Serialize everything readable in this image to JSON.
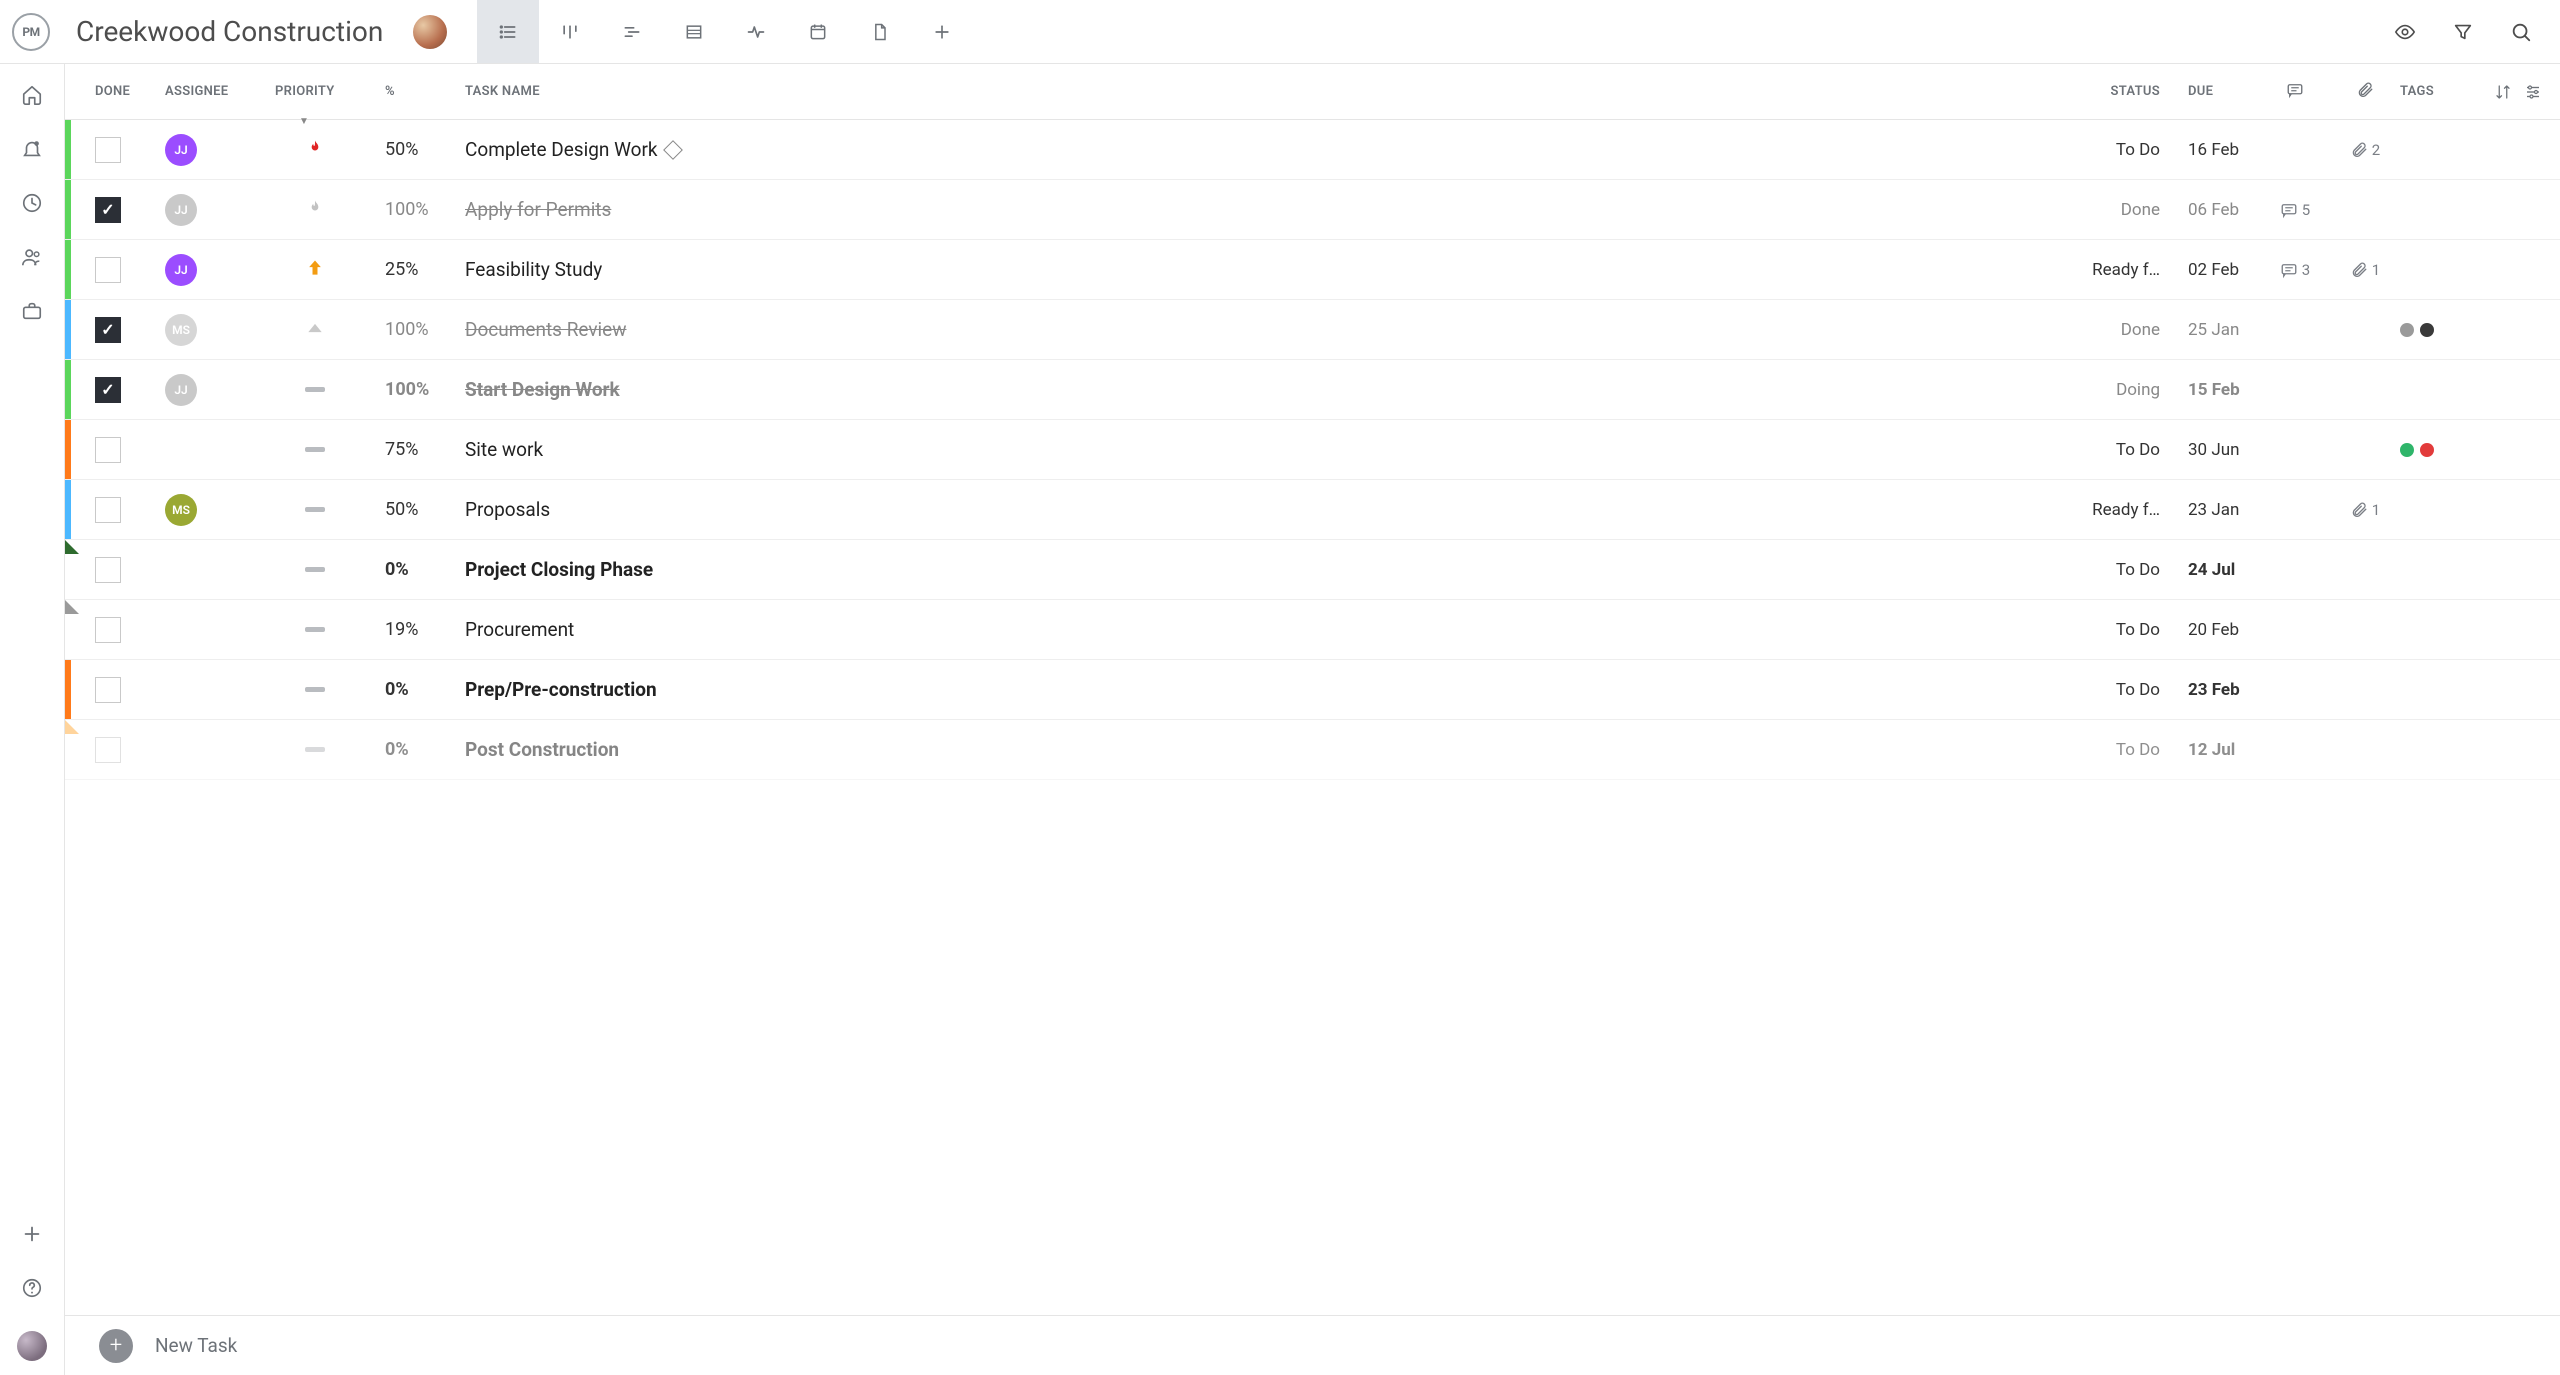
{
  "header": {
    "logo_text": "PM",
    "project_title": "Creekwood Construction"
  },
  "columns": {
    "done": "DONE",
    "assignee": "ASSIGNEE",
    "priority": "PRIORITY",
    "pct": "%",
    "name": "TASK NAME",
    "status": "STATUS",
    "due": "DUE",
    "tags": "TAGS"
  },
  "footer": {
    "new_task": "New Task"
  },
  "tasks": [
    {
      "done": false,
      "assignee": {
        "initials": "JJ",
        "color": "#9b4dff"
      },
      "priority": "flame-red",
      "pct": "50%",
      "name": "Complete Design Work",
      "milestone": true,
      "status": "To Do",
      "due": "16 Feb",
      "comments": null,
      "attachments": "2",
      "tags": [],
      "stripe": "#5bd65b",
      "bold": false
    },
    {
      "done": true,
      "assignee": {
        "initials": "JJ",
        "color": "#c9c9c9"
      },
      "priority": "flame-grey",
      "pct": "100%",
      "name": "Apply for Permits",
      "status": "Done",
      "due": "06 Feb",
      "comments": "5",
      "attachments": null,
      "tags": [],
      "stripe": "#5bd65b",
      "bold": false
    },
    {
      "done": false,
      "assignee": {
        "initials": "JJ",
        "color": "#9b4dff"
      },
      "priority": "arrow-orange",
      "pct": "25%",
      "name": "Feasibility Study",
      "status": "Ready f…",
      "due": "02 Feb",
      "comments": "3",
      "attachments": "1",
      "tags": [],
      "stripe": "#5bd65b",
      "bold": false
    },
    {
      "done": true,
      "assignee": {
        "initials": "MS",
        "color": "#d6d6d6"
      },
      "priority": "triangle-grey",
      "pct": "100%",
      "name": "Documents Review",
      "status": "Done",
      "due": "25 Jan",
      "comments": null,
      "attachments": null,
      "tags": [
        "#9a9a9a",
        "#3a3a3a"
      ],
      "stripe": "#4cb8ff",
      "bold": false
    },
    {
      "done": true,
      "assignee": {
        "initials": "JJ",
        "color": "#c9c9c9"
      },
      "priority": "dash",
      "pct": "100%",
      "name": "Start Design Work",
      "status": "Doing",
      "due": "15 Feb",
      "comments": null,
      "attachments": null,
      "tags": [],
      "stripe": "#5bd65b",
      "bold": true
    },
    {
      "done": false,
      "assignee": null,
      "priority": "dash",
      "pct": "75%",
      "name": "Site work",
      "status": "To Do",
      "due": "30 Jun",
      "comments": null,
      "attachments": null,
      "tags": [
        "#2fb56a",
        "#e23b3b"
      ],
      "stripe": "#ff7a1a",
      "bold": false
    },
    {
      "done": false,
      "assignee": {
        "initials": "MS",
        "color": "#9aa833"
      },
      "priority": "dash",
      "pct": "50%",
      "name": "Proposals",
      "status": "Ready f…",
      "due": "23 Jan",
      "comments": null,
      "attachments": "1",
      "tags": [],
      "stripe": "#4cb8ff",
      "bold": false
    },
    {
      "done": false,
      "assignee": null,
      "priority": "dash",
      "pct": "0%",
      "name": "Project Closing Phase",
      "status": "To Do",
      "due": "24 Jul",
      "comments": null,
      "attachments": null,
      "tags": [],
      "notch": "#2e6b2e",
      "bold": true
    },
    {
      "done": false,
      "assignee": null,
      "priority": "dash",
      "pct": "19%",
      "name": "Procurement",
      "status": "To Do",
      "due": "20 Feb",
      "comments": null,
      "attachments": null,
      "tags": [],
      "notch": "#9a9a9a",
      "bold": false
    },
    {
      "done": false,
      "assignee": null,
      "priority": "dash",
      "pct": "0%",
      "name": "Prep/Pre-construction",
      "status": "To Do",
      "due": "23 Feb",
      "comments": null,
      "attachments": null,
      "tags": [],
      "stripe": "#ff7a1a",
      "bold": true
    },
    {
      "done": false,
      "assignee": null,
      "priority": "dash",
      "pct": "0%",
      "name": "Post Construction",
      "status": "To Do",
      "due": "12 Jul",
      "comments": null,
      "attachments": null,
      "tags": [],
      "notch": "#ffb24d",
      "bold": true,
      "faded": true
    }
  ]
}
